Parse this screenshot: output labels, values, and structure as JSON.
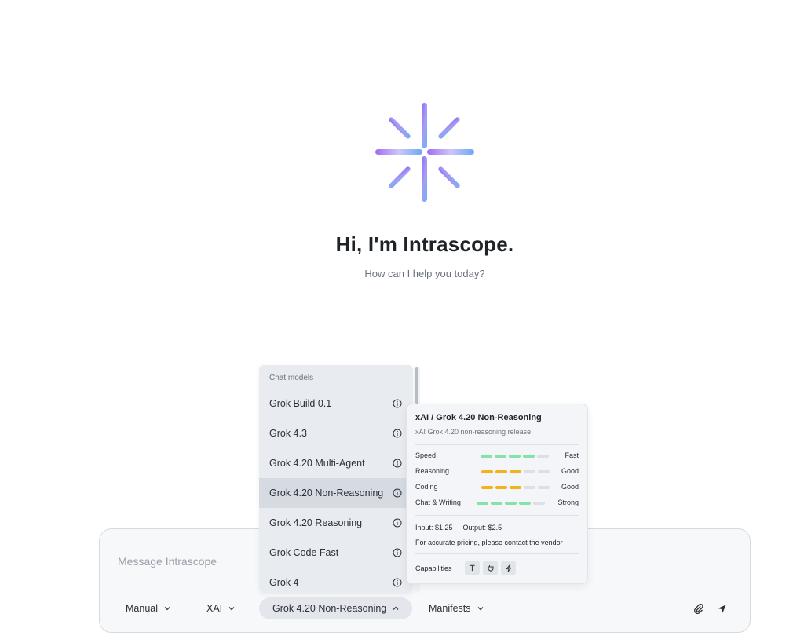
{
  "hero": {
    "title": "Hi, I'm Intrascope.",
    "subtitle": "How can I help you today?",
    "logo_icon": "sparkle-star-logo"
  },
  "composer": {
    "placeholder": "Message Intrascope",
    "value": "",
    "mode_label": "Manual",
    "provider_label": "XAI",
    "model_label": "Grok 4.20 Non-Reasoning",
    "manifests_label": "Manifests",
    "attach_icon": "paperclip-icon",
    "send_icon": "send-arrow-icon"
  },
  "model_dropdown": {
    "header": "Chat models",
    "items": [
      {
        "label": "Grok Build 0.1",
        "selected": false
      },
      {
        "label": "Grok 4.3",
        "selected": false
      },
      {
        "label": "Grok 4.20 Multi-Agent",
        "selected": false
      },
      {
        "label": "Grok 4.20 Non-Reasoning",
        "selected": true
      },
      {
        "label": "Grok 4.20 Reasoning",
        "selected": false
      },
      {
        "label": "Grok Code Fast",
        "selected": false
      },
      {
        "label": "Grok 4",
        "selected": false
      }
    ]
  },
  "model_card": {
    "title": "xAI / Grok 4.20 Non-Reasoning",
    "subtitle": "xAI Grok 4.20 non-reasoning release",
    "metrics": [
      {
        "label": "Speed",
        "value": "Fast",
        "level": 4,
        "max": 5,
        "color": "#86e3a6"
      },
      {
        "label": "Reasoning",
        "value": "Good",
        "level": 3,
        "max": 5,
        "color": "#f2b21b"
      },
      {
        "label": "Coding",
        "value": "Good",
        "level": 3,
        "max": 5,
        "color": "#f2b21b"
      },
      {
        "label": "Chat & Writing",
        "value": "Strong",
        "level": 4,
        "max": 5,
        "color": "#86e3a6"
      }
    ],
    "input_price": "Input: $1.25",
    "output_price": "Output: $2.5",
    "pricing_note": "For accurate pricing, please contact the vendor",
    "capabilities_label": "Capabilities",
    "capabilities": [
      "text-icon",
      "plug-icon",
      "lightning-icon"
    ]
  },
  "colors": {
    "accent_green": "#86e3a6",
    "accent_yellow": "#f2b21b",
    "selected_bg": "#d6dbe2"
  }
}
